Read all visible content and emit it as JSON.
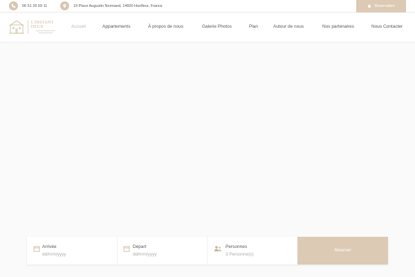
{
  "topbar": {
    "phone": "06 51 26 69 11",
    "address": "19 Place Augustin Normand, 14600 Honfleur, France",
    "reservation_label": "Réservation"
  },
  "logo": {
    "text": "L'INSTANT DEUX"
  },
  "nav": {
    "items": [
      {
        "label": "Accueil",
        "active": true
      },
      {
        "label": "Appartements"
      },
      {
        "label": "À propos de nous"
      },
      {
        "label": "Galerie Photos"
      },
      {
        "label": "Plan"
      },
      {
        "label": "Autour de nous"
      },
      {
        "label": "Nos partenaires"
      },
      {
        "label": "Nous Contacter"
      }
    ]
  },
  "booking": {
    "arrival_label": "Arrivée",
    "arrival_placeholder": "dd/mm/yyyy",
    "departure_label": "Départ",
    "departure_placeholder": "dd/mm/yyyy",
    "persons_label": "Personnes",
    "persons_value": "3 Personne(s)",
    "submit_label": "Réserver"
  },
  "colors": {
    "accent": "#dccab4",
    "nav_text": "#555555",
    "nav_active": "#b9b9b9"
  }
}
